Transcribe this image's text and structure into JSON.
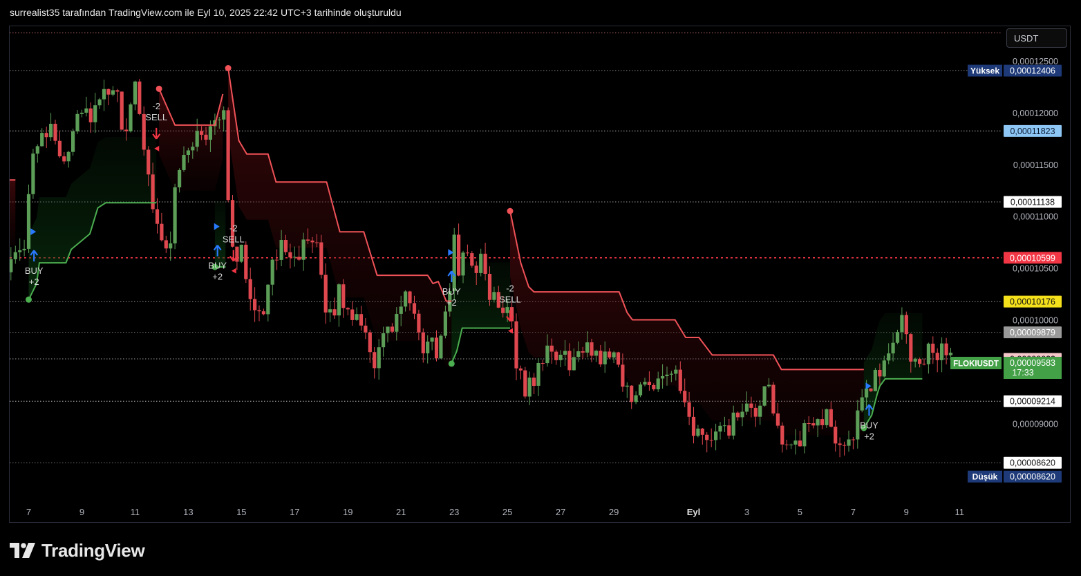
{
  "header": {
    "attribution": "surrealist35 tarafından TradingView.com ile Eyl 10, 2025 22:42 UTC+3 tarihinde oluşturuldu"
  },
  "currency": "USDT",
  "brand": {
    "name": "TradingView"
  },
  "colors": {
    "background": "#000000",
    "up": "#5c9e57",
    "down": "#e0484f",
    "trail_up": "#4caf50",
    "trail_down": "#f05258",
    "grid_dot": "#c8c8c8",
    "resistance": "#f23645"
  },
  "chart_data": {
    "type": "candlestick",
    "symbol": "FLOKIUSDT",
    "ylim": [
      8.45e-05,
      0.0001288
    ],
    "x_tick_labels": [
      {
        "label": "7",
        "day": 7
      },
      {
        "label": "9",
        "day": 9
      },
      {
        "label": "11",
        "day": 11
      },
      {
        "label": "13",
        "day": 13
      },
      {
        "label": "15",
        "day": 15
      },
      {
        "label": "17",
        "day": 17
      },
      {
        "label": "19",
        "day": 19
      },
      {
        "label": "21",
        "day": 21
      },
      {
        "label": "23",
        "day": 23
      },
      {
        "label": "25",
        "day": 25
      },
      {
        "label": "27",
        "day": 27
      },
      {
        "label": "29",
        "day": 29
      },
      {
        "label": "Eyl",
        "day": 32
      },
      {
        "label": "3",
        "day": 34
      },
      {
        "label": "5",
        "day": 36
      },
      {
        "label": "7",
        "day": 38
      },
      {
        "label": "9",
        "day": 40
      },
      {
        "label": "11",
        "day": 42
      }
    ],
    "y_tick_labels": [
      {
        "label": "0,00012500",
        "value": 0.000125
      },
      {
        "label": "0,00012000",
        "value": 0.00012
      },
      {
        "label": "0,00011500",
        "value": 0.000115
      },
      {
        "label": "0,00011000",
        "value": 0.00011
      },
      {
        "label": "0,00010500",
        "value": 0.000105
      },
      {
        "label": "0,00010000",
        "value": 0.0001
      },
      {
        "label": "0,00009000",
        "value": 9e-05
      }
    ],
    "price_markers": [
      {
        "label": "0,00012406",
        "value": 0.00012406,
        "bg": "#1e3a78",
        "fg": "#ffffff",
        "tag": "Yüksek"
      },
      {
        "label": "0,00011823",
        "value": 0.00011823,
        "bg": "#8ec7f5",
        "fg": "#0a1a33",
        "tag": ""
      },
      {
        "label": "0,00011138",
        "value": 0.00011138,
        "bg": "#ffffff",
        "fg": "#111111",
        "tag": ""
      },
      {
        "label": "0,00010599",
        "value": 0.00010599,
        "bg": "#f23645",
        "fg": "#ffffff",
        "tag": ""
      },
      {
        "label": "0,00010176",
        "value": 0.00010176,
        "bg": "#f5e11b",
        "fg": "#111111",
        "tag": ""
      },
      {
        "label": "0,00009879",
        "value": 9.879e-05,
        "bg": "#9a9a9a",
        "fg": "#ffffff",
        "tag": ""
      },
      {
        "label": "0,00009623",
        "value": 9.623e-05,
        "bg": "#f5c6c9",
        "fg": "#111111",
        "tag": ""
      },
      {
        "label": "0,00009582",
        "value": 9.582e-05,
        "bg": "#2962ff",
        "fg": "#ffffff",
        "tag": ""
      },
      {
        "label": "0,00009214",
        "value": 9.214e-05,
        "bg": "#ffffff",
        "fg": "#111111",
        "tag": ""
      },
      {
        "label": "0,00008620",
        "value": 8.62e-05,
        "bg": "#ffffff",
        "fg": "#111111",
        "tag": ""
      },
      {
        "label": "0,00008620",
        "value": 8.62e-05,
        "bg": "#1e3a78",
        "fg": "#ffffff",
        "tag": "Düşük"
      }
    ],
    "last_price": {
      "label": "0,00009583",
      "value": 9.583e-05,
      "countdown": "17:33",
      "symbol_tag": "FLOKIUSDT",
      "bg": "#43a047"
    },
    "levels": [
      {
        "value": 0.00012406,
        "style": "dotted",
        "color": "#bdbdbd"
      },
      {
        "value": 0.00011823,
        "style": "dotted",
        "color": "#ffffff"
      },
      {
        "value": 0.00011138,
        "style": "dotted",
        "color": "#cfcfcf"
      },
      {
        "value": 0.00010599,
        "style": "dashed",
        "color": "#f23645"
      },
      {
        "value": 0.00010176,
        "style": "dotted",
        "color": "#cfcfcf"
      },
      {
        "value": 9.879e-05,
        "style": "dotted",
        "color": "#9a9a9a"
      },
      {
        "value": 9.623e-05,
        "style": "dotted",
        "color": "#cfcfcf"
      },
      {
        "value": 9.214e-05,
        "style": "dotted",
        "color": "#ffffff"
      },
      {
        "value": 8.62e-05,
        "style": "dotted",
        "color": "#9a9a9a"
      },
      {
        "value": 0.0001277,
        "style": "dotted",
        "color": "#f58b8b"
      }
    ],
    "trail_segments": [
      {
        "side": "down",
        "points": [
          [
            5.5,
            0.0001135
          ],
          [
            6.5,
            0.0001135
          ]
        ]
      },
      {
        "side": "up",
        "points": [
          [
            7.0,
            0.00010195
          ],
          [
            7.3,
            0.0001035
          ],
          [
            7.4,
            0.0001055
          ],
          [
            8.4,
            0.0001055
          ],
          [
            8.6,
            0.0001068
          ],
          [
            9.3,
            0.0001083
          ],
          [
            9.6,
            0.0001108
          ],
          [
            9.9,
            0.0001113
          ],
          [
            11.8,
            0.0001113
          ]
        ]
      },
      {
        "side": "down",
        "points": [
          [
            11.9,
            0.0001223
          ],
          [
            12.5,
            0.0001188
          ],
          [
            14.0,
            0.0001188
          ],
          [
            14.3,
            0.0001218
          ]
        ]
      },
      {
        "side": "up",
        "points": [
          [
            14.0,
            0.0001051
          ],
          [
            14.4,
            0.0001051
          ]
        ]
      },
      {
        "side": "down",
        "points": [
          [
            14.5,
            0.0001243
          ],
          [
            14.9,
            0.0001173
          ],
          [
            15.2,
            0.000116
          ],
          [
            16.0,
            0.000116
          ],
          [
            16.3,
            0.0001133
          ],
          [
            18.2,
            0.0001133
          ],
          [
            18.7,
            0.0001085
          ],
          [
            19.6,
            0.0001085
          ],
          [
            20.1,
            0.0001043
          ],
          [
            22.0,
            0.0001043
          ],
          [
            22.2,
            0.0001035
          ],
          [
            22.4,
            0.0001037
          ],
          [
            22.7,
            0.0001018
          ],
          [
            22.9,
            0.0001018
          ]
        ]
      },
      {
        "side": "up",
        "points": [
          [
            22.9,
            9.577e-05
          ],
          [
            23.1,
            9.7e-05
          ],
          [
            23.3,
            9.92e-05
          ],
          [
            25.1,
            9.92e-05
          ]
        ]
      },
      {
        "side": "down",
        "points": [
          [
            25.1,
            0.0001105
          ],
          [
            25.5,
            0.0001055
          ],
          [
            25.8,
            0.0001032
          ],
          [
            26.0,
            0.0001027
          ],
          [
            29.2,
            0.0001027
          ],
          [
            29.5,
            0.0001007
          ],
          [
            29.7,
            0.0001
          ],
          [
            31.3,
            0.0001
          ],
          [
            31.7,
            9.83e-05
          ],
          [
            32.2,
            9.83e-05
          ],
          [
            32.7,
            9.66e-05
          ],
          [
            35.0,
            9.66e-05
          ],
          [
            35.3,
            9.52e-05
          ],
          [
            38.4,
            9.52e-05
          ]
        ]
      },
      {
        "side": "up",
        "points": [
          [
            38.4,
            8.955e-05
          ],
          [
            38.7,
            9.08e-05
          ],
          [
            38.9,
            9.28e-05
          ],
          [
            39.0,
            9.36e-05
          ],
          [
            39.2,
            9.43e-05
          ],
          [
            40.6,
            9.43e-05
          ]
        ]
      }
    ],
    "signals": [
      {
        "type": "buy",
        "day": 7.2,
        "value": 0.0001055,
        "line1": "BUY",
        "line2": "+2"
      },
      {
        "type": "sell",
        "day": 11.8,
        "value": 0.0001188,
        "line1": "-2",
        "line2": "SELL"
      },
      {
        "type": "buy",
        "day": 14.1,
        "value": 0.000106,
        "line1": "BUY",
        "line2": "+2"
      },
      {
        "type": "sell",
        "day": 14.7,
        "value": 0.000107,
        "line1": "-2",
        "line2": "SELL"
      },
      {
        "type": "buy",
        "day": 22.9,
        "value": 0.0001035,
        "line1": "BUY",
        "line2": "+2"
      },
      {
        "type": "sell",
        "day": 25.1,
        "value": 0.0001012,
        "line1": "-2",
        "line2": "SELL"
      },
      {
        "type": "buy",
        "day": 38.6,
        "value": 9.06e-05,
        "line1": "BUY",
        "line2": "+2"
      }
    ],
    "trail_start_dots": [
      {
        "side": "up",
        "day": 7.0,
        "value": 0.00010195
      },
      {
        "side": "down",
        "day": 11.9,
        "value": 0.0001223
      },
      {
        "side": "up",
        "day": 14.0,
        "value": 0.0001051
      },
      {
        "side": "down",
        "day": 14.5,
        "value": 0.0001243
      },
      {
        "side": "up",
        "day": 22.9,
        "value": 9.577e-05
      },
      {
        "side": "down",
        "day": 25.1,
        "value": 0.0001105
      },
      {
        "side": "up",
        "day": 38.4,
        "value": 8.955e-05
      }
    ],
    "candle_anchors": [
      [
        5.5,
        0.000105
      ],
      [
        6.2,
        0.0001048
      ],
      [
        6.8,
        0.0001068
      ],
      [
        7.2,
        0.0001175
      ],
      [
        7.7,
        0.0001185
      ],
      [
        8.4,
        0.0001155
      ],
      [
        8.8,
        0.0001205
      ],
      [
        9.4,
        0.0001198
      ],
      [
        9.8,
        0.0001212
      ],
      [
        10.2,
        0.0001225
      ],
      [
        10.6,
        0.000118
      ],
      [
        11.0,
        0.000122
      ],
      [
        11.4,
        0.000116
      ],
      [
        11.7,
        0.000111
      ],
      [
        12.0,
        0.0001075
      ],
      [
        12.3,
        0.000107
      ],
      [
        12.5,
        0.000113
      ],
      [
        12.9,
        0.0001162
      ],
      [
        13.3,
        0.0001178
      ],
      [
        13.6,
        0.0001172
      ],
      [
        13.9,
        0.0001195
      ],
      [
        14.1,
        0.0001195
      ],
      [
        14.3,
        0.0001215
      ],
      [
        14.5,
        0.000111
      ],
      [
        14.8,
        0.0001055
      ],
      [
        15.0,
        0.0001063
      ],
      [
        15.3,
        0.0001025
      ],
      [
        15.6,
        0.0001012
      ],
      [
        15.8,
        0.0001008
      ],
      [
        16.0,
        0.0001035
      ],
      [
        16.3,
        0.0001058
      ],
      [
        16.6,
        0.0001078
      ],
      [
        16.9,
        0.0001065
      ],
      [
        17.3,
        0.0001068
      ],
      [
        17.6,
        0.0001072
      ],
      [
        17.9,
        0.0001062
      ],
      [
        18.1,
        0.0001005
      ],
      [
        18.4,
        0.000101
      ],
      [
        18.7,
        0.0001025
      ],
      [
        19.0,
        0.0001005
      ],
      [
        19.4,
        0.000101
      ],
      [
        19.7,
        9.85e-05
      ],
      [
        20.0,
        9.6e-05
      ],
      [
        20.3,
        9.82e-05
      ],
      [
        20.6,
        9.85e-05
      ],
      [
        20.9,
        0.000101
      ],
      [
        21.2,
        0.0001025
      ],
      [
        21.5,
        9.95e-05
      ],
      [
        21.8,
        9.72e-05
      ],
      [
        22.1,
        9.78e-05
      ],
      [
        22.4,
        9.7e-05
      ],
      [
        22.6,
        9.85e-05
      ],
      [
        22.8,
        0.0001022
      ],
      [
        23.0,
        0.0001082
      ],
      [
        23.2,
        0.0001048
      ],
      [
        23.5,
        0.0001065
      ],
      [
        23.8,
        0.0001052
      ],
      [
        24.1,
        0.0001055
      ],
      [
        24.3,
        0.000102
      ],
      [
        24.6,
        0.0001025
      ],
      [
        24.8,
        0.000101
      ],
      [
        25.1,
        0.000102
      ],
      [
        25.3,
        9.68e-05
      ],
      [
        25.6,
        9.3e-05
      ],
      [
        25.9,
        9.4e-05
      ],
      [
        26.2,
        9.55e-05
      ],
      [
        26.5,
        9.65e-05
      ],
      [
        26.8,
        9.7e-05
      ],
      [
        27.1,
        9.62e-05
      ],
      [
        27.4,
        9.6e-05
      ],
      [
        27.8,
        9.68e-05
      ],
      [
        28.2,
        9.72e-05
      ],
      [
        28.6,
        9.62e-05
      ],
      [
        28.9,
        9.75e-05
      ],
      [
        29.1,
        9.6e-05
      ],
      [
        29.4,
        9.4e-05
      ],
      [
        29.7,
        9.15e-05
      ],
      [
        29.9,
        9.3e-05
      ],
      [
        30.2,
        9.48e-05
      ],
      [
        30.5,
        9.42e-05
      ],
      [
        30.8,
        9.48e-05
      ],
      [
        31.1,
        9.55e-05
      ],
      [
        31.4,
        9.4e-05
      ],
      [
        31.7,
        9.1e-05
      ],
      [
        32.0,
        8.85e-05
      ],
      [
        32.3,
        8.95e-05
      ],
      [
        32.6,
        8.8e-05
      ],
      [
        32.9,
        8.88e-05
      ],
      [
        33.2,
        8.9e-05
      ],
      [
        33.5,
        9.02e-05
      ],
      [
        33.9,
        9.12e-05
      ],
      [
        34.2,
        9.05e-05
      ],
      [
        34.5,
        9.18e-05
      ],
      [
        34.8,
        9.32e-05
      ],
      [
        35.1,
        9.05e-05
      ],
      [
        35.4,
        8.85e-05
      ],
      [
        35.7,
        8.7e-05
      ],
      [
        36.0,
        8.8e-05
      ],
      [
        36.3,
        8.98e-05
      ],
      [
        36.6,
        9.02e-05
      ],
      [
        36.9,
        9.1e-05
      ],
      [
        37.2,
        8.9e-05
      ],
      [
        37.5,
        8.85e-05
      ],
      [
        37.8,
        8.8e-05
      ],
      [
        38.1,
        9e-05
      ],
      [
        38.4,
        9.2e-05
      ],
      [
        38.7,
        9.4e-05
      ],
      [
        39.0,
        9.45e-05
      ],
      [
        39.2,
        9.7e-05
      ],
      [
        39.5,
        9.82e-05
      ],
      [
        39.8,
        9.95e-05
      ],
      [
        40.0,
        9.88e-05
      ],
      [
        40.2,
        9.65e-05
      ],
      [
        40.5,
        9.55e-05
      ],
      [
        40.8,
        9.68e-05
      ],
      [
        41.1,
        9.72e-05
      ],
      [
        41.4,
        9.68e-05
      ],
      [
        41.6,
        9.8e-05
      ],
      [
        41.7,
        9.58e-05
      ]
    ]
  }
}
